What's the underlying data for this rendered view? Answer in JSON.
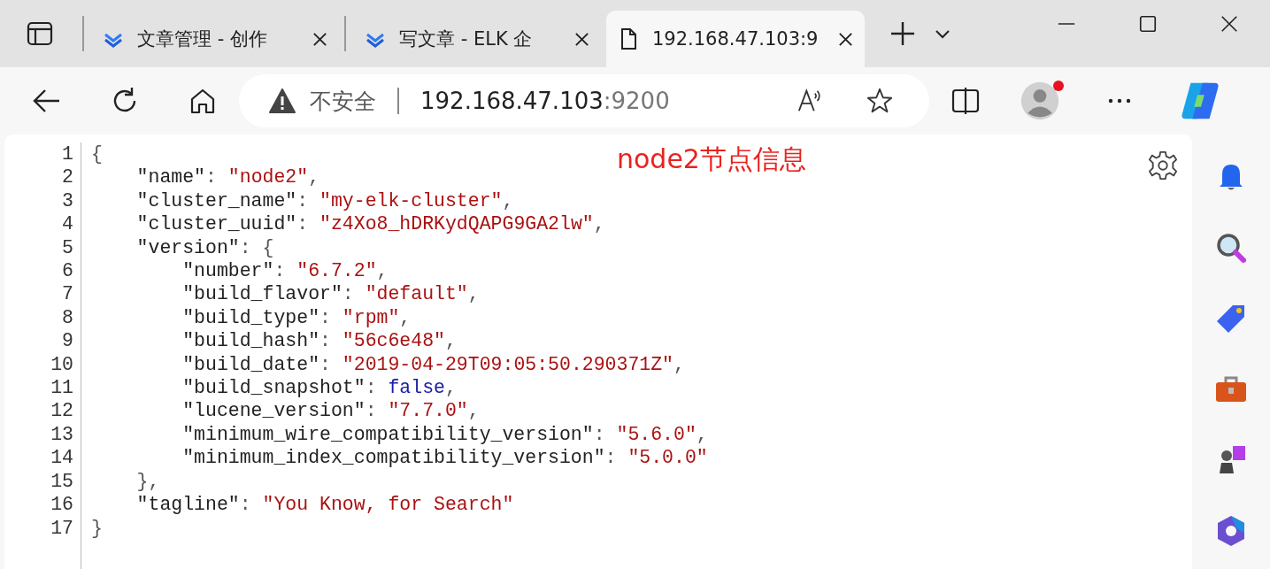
{
  "tabs": [
    {
      "title": "文章管理 - 创作",
      "kind": "site",
      "selected": false
    },
    {
      "title": "写文章 - ELK 企",
      "kind": "site",
      "selected": false
    },
    {
      "title": "192.168.47.103:9",
      "kind": "page",
      "selected": true
    }
  ],
  "address_bar": {
    "security": "不安全",
    "host": "192.168.47.103",
    "port": ":9200"
  },
  "annotation": "node2节点信息",
  "code": {
    "lines": [
      {
        "number": "1",
        "tokens": [
          {
            "kind": "punct",
            "text": "{"
          }
        ],
        "children": [
          {
            "number": "2",
            "tokens": [
              {
                "kind": "key",
                "text": "\"name\""
              },
              {
                "kind": "punct",
                "text": ": "
              },
              {
                "kind": "string",
                "text": "\"node2\""
              },
              {
                "kind": "punct",
                "text": ","
              }
            ]
          },
          {
            "number": "3",
            "tokens": [
              {
                "kind": "key",
                "text": "\"cluster_name\""
              },
              {
                "kind": "punct",
                "text": ": "
              },
              {
                "kind": "string",
                "text": "\"my-elk-cluster\""
              },
              {
                "kind": "punct",
                "text": ","
              }
            ]
          },
          {
            "number": "4",
            "tokens": [
              {
                "kind": "key",
                "text": "\"cluster_uuid\""
              },
              {
                "kind": "punct",
                "text": ": "
              },
              {
                "kind": "string",
                "text": "\"z4Xo8_hDRKydQAPG9GA2lw\""
              },
              {
                "kind": "punct",
                "text": ","
              }
            ]
          },
          {
            "number": "5",
            "tokens": [
              {
                "kind": "key",
                "text": "\"version\""
              },
              {
                "kind": "punct",
                "text": ": {"
              }
            ],
            "children": [
              {
                "number": "6",
                "tokens": [
                  {
                    "kind": "key",
                    "text": "\"number\""
                  },
                  {
                    "kind": "punct",
                    "text": ": "
                  },
                  {
                    "kind": "string",
                    "text": "\"6.7.2\""
                  },
                  {
                    "kind": "punct",
                    "text": ","
                  }
                ]
              },
              {
                "number": "7",
                "tokens": [
                  {
                    "kind": "key",
                    "text": "\"build_flavor\""
                  },
                  {
                    "kind": "punct",
                    "text": ": "
                  },
                  {
                    "kind": "string",
                    "text": "\"default\""
                  },
                  {
                    "kind": "punct",
                    "text": ","
                  }
                ]
              },
              {
                "number": "8",
                "tokens": [
                  {
                    "kind": "key",
                    "text": "\"build_type\""
                  },
                  {
                    "kind": "punct",
                    "text": ": "
                  },
                  {
                    "kind": "string",
                    "text": "\"rpm\""
                  },
                  {
                    "kind": "punct",
                    "text": ","
                  }
                ]
              },
              {
                "number": "9",
                "tokens": [
                  {
                    "kind": "key",
                    "text": "\"build_hash\""
                  },
                  {
                    "kind": "punct",
                    "text": ": "
                  },
                  {
                    "kind": "string",
                    "text": "\"56c6e48\""
                  },
                  {
                    "kind": "punct",
                    "text": ","
                  }
                ]
              },
              {
                "number": "10",
                "tokens": [
                  {
                    "kind": "key",
                    "text": "\"build_date\""
                  },
                  {
                    "kind": "punct",
                    "text": ": "
                  },
                  {
                    "kind": "string",
                    "text": "\"2019-04-29T09:05:50.290371Z\""
                  },
                  {
                    "kind": "punct",
                    "text": ","
                  }
                ]
              },
              {
                "number": "11",
                "tokens": [
                  {
                    "kind": "key",
                    "text": "\"build_snapshot\""
                  },
                  {
                    "kind": "punct",
                    "text": ": "
                  },
                  {
                    "kind": "literal",
                    "text": "false"
                  },
                  {
                    "kind": "punct",
                    "text": ","
                  }
                ]
              },
              {
                "number": "12",
                "tokens": [
                  {
                    "kind": "key",
                    "text": "\"lucene_version\""
                  },
                  {
                    "kind": "punct",
                    "text": ": "
                  },
                  {
                    "kind": "string",
                    "text": "\"7.7.0\""
                  },
                  {
                    "kind": "punct",
                    "text": ","
                  }
                ]
              },
              {
                "number": "13",
                "tokens": [
                  {
                    "kind": "key",
                    "text": "\"minimum_wire_compatibility_version\""
                  },
                  {
                    "kind": "punct",
                    "text": ": "
                  },
                  {
                    "kind": "string",
                    "text": "\"5.6.0\""
                  },
                  {
                    "kind": "punct",
                    "text": ","
                  }
                ]
              },
              {
                "number": "14",
                "tokens": [
                  {
                    "kind": "key",
                    "text": "\"minimum_index_compatibility_version\""
                  },
                  {
                    "kind": "punct",
                    "text": ": "
                  },
                  {
                    "kind": "string",
                    "text": "\"5.0.0\""
                  }
                ]
              }
            ]
          },
          {
            "number": "15",
            "tokens": [
              {
                "kind": "punct",
                "text": "},"
              }
            ]
          },
          {
            "number": "16",
            "tokens": [
              {
                "kind": "key",
                "text": "\"tagline\""
              },
              {
                "kind": "punct",
                "text": ": "
              },
              {
                "kind": "string",
                "text": "\"You Know, for Search\""
              }
            ]
          }
        ]
      },
      {
        "number": "17",
        "tokens": [
          {
            "kind": "punct",
            "text": "}"
          }
        ]
      }
    ]
  }
}
